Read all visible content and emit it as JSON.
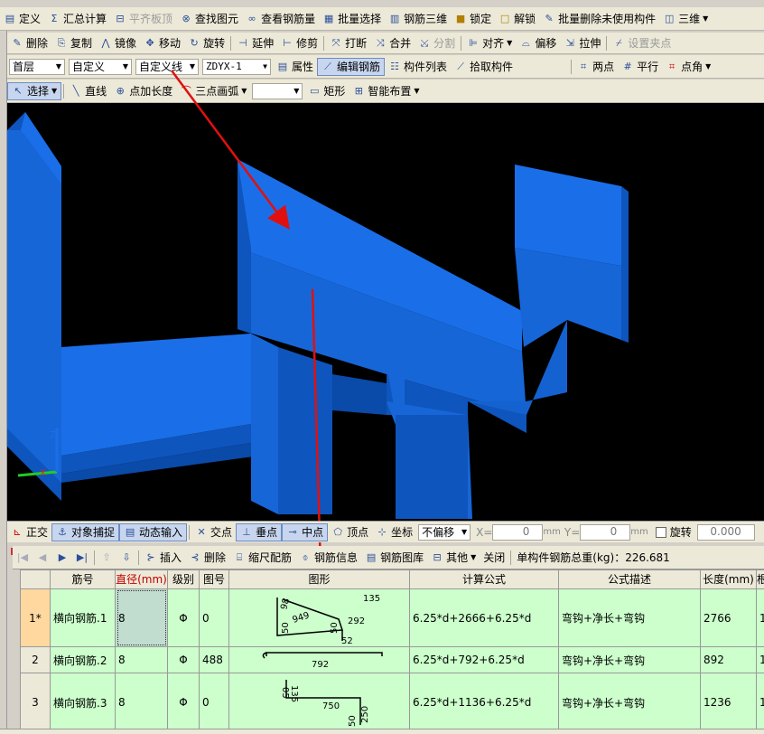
{
  "menu_row1": [
    {
      "icon": "define-icon",
      "label": "定义",
      "enabled": true
    },
    {
      "icon": "sigma-icon",
      "label": "汇总计算",
      "enabled": true
    },
    {
      "icon": "slab-align-icon",
      "label": "平齐板顶",
      "enabled": false
    },
    {
      "icon": "binoculars-icon",
      "label": "查找图元",
      "enabled": true
    },
    {
      "icon": "glasses-icon",
      "label": "查看钢筋量",
      "enabled": true
    },
    {
      "icon": "batch-select-icon",
      "label": "批量选择",
      "enabled": true
    },
    {
      "icon": "rebar-3d-icon",
      "label": "钢筋三维",
      "enabled": true
    },
    {
      "icon": "lock-icon",
      "label": "锁定",
      "enabled": true
    },
    {
      "icon": "unlock-icon",
      "label": "解锁",
      "enabled": true
    },
    {
      "icon": "batch-delete-icon",
      "label": "批量删除未使用构件",
      "enabled": true
    },
    {
      "icon": "cube-3d-icon",
      "label": "三维",
      "enabled": true
    }
  ],
  "edit_row": [
    {
      "icon": "delete-icon",
      "label": "删除",
      "enabled": true
    },
    {
      "icon": "copy-icon",
      "label": "复制",
      "enabled": true
    },
    {
      "icon": "mirror-icon",
      "label": "镜像",
      "enabled": true
    },
    {
      "icon": "move-icon",
      "label": "移动",
      "enabled": true
    },
    {
      "icon": "rotate-icon",
      "label": "旋转",
      "enabled": true
    },
    {
      "icon": "extend-icon",
      "label": "延伸",
      "enabled": true
    },
    {
      "icon": "trim-icon",
      "label": "修剪",
      "enabled": true
    },
    {
      "icon": "break-icon",
      "label": "打断",
      "enabled": true
    },
    {
      "icon": "merge-icon",
      "label": "合并",
      "enabled": true
    },
    {
      "icon": "split-icon",
      "label": "分割",
      "enabled": false
    },
    {
      "icon": "align-icon",
      "label": "对齐",
      "enabled": true
    },
    {
      "icon": "offset-icon",
      "label": "偏移",
      "enabled": true
    },
    {
      "icon": "stretch-icon",
      "label": "拉伸",
      "enabled": true
    },
    {
      "icon": "set-grip-icon",
      "label": "设置夹点",
      "enabled": false
    }
  ],
  "selectors": {
    "floor": "首层",
    "category": "自定义",
    "type": "自定义线",
    "component": "ZDYX-1",
    "properties": "属性",
    "edit_rebar": "编辑钢筋",
    "component_list": "构件列表",
    "pick_component": "拾取构件",
    "two_points": "两点",
    "parallel": "平行",
    "point_angle": "点角"
  },
  "draw_row": {
    "select": "选择",
    "line": "直线",
    "point_length": "点加长度",
    "arc": "三点画弧",
    "arc_value": "",
    "rect": "矩形",
    "smart": "智能布置"
  },
  "snap_bar": {
    "ortho": "正交",
    "snap": "对象捕捉",
    "dynamic": "动态输入",
    "intersection": "交点",
    "perpendicular": "垂点",
    "midpoint": "中点",
    "vertex": "顶点",
    "coordinate": "坐标",
    "offset_mode": "不偏移",
    "x_label": "X=",
    "x_value": "0",
    "y_label": "Y=",
    "y_value": "0",
    "unit": "mm",
    "rotate": "旋转",
    "rotate_value": "0.000"
  },
  "rebar_bar": {
    "insert": "插入",
    "delete": "删除",
    "scale_config": "缩尺配筋",
    "rebar_info": "钢筋信息",
    "rebar_library": "钢筋图库",
    "others": "其他",
    "close": "关闭",
    "total_weight": "单构件钢筋总重(kg)：226.681"
  },
  "table": {
    "headers": [
      "",
      "筋号",
      "直径(mm)",
      "级别",
      "图号",
      "图形",
      "计算公式",
      "公式描述",
      "长度(mm)",
      "根"
    ],
    "rows": [
      {
        "row": "1*",
        "name": "横向钢筋.1",
        "dia": "8",
        "grade": "Φ",
        "fig": "0",
        "formula": "6.25*d+2666+6.25*d",
        "desc": "弯钩+净长+弯钩",
        "len": "2766",
        "count": "1"
      },
      {
        "row": "2",
        "name": "横向钢筋.2",
        "dia": "8",
        "grade": "Φ",
        "fig": "488",
        "formula": "6.25*d+792+6.25*d",
        "desc": "弯钩+净长+弯钩",
        "len": "892",
        "count": "1"
      },
      {
        "row": "3",
        "name": "横向钢筋.3",
        "dia": "8",
        "grade": "Φ",
        "fig": "0",
        "formula": "6.25*d+1136+6.25*d",
        "desc": "弯钩+净长+弯钩",
        "len": "1236",
        "count": "1"
      }
    ],
    "shape_labels": {
      "r1_a": "135",
      "r1_b": "949",
      "r1_c": "98",
      "r1_d": "50",
      "r1_e": "292",
      "r1_f": "52",
      "r1_g": "50",
      "r2": "792",
      "r3_a": "05",
      "r3_b": "135",
      "r3_c": "750",
      "r3_d": "250",
      "r3_e": "50"
    }
  },
  "colors": {
    "model": "#1a6fe8",
    "model_dark": "#0e55bd",
    "background": "#000000",
    "grid_bg": "#ccffcc",
    "annotation": "#e01010"
  }
}
